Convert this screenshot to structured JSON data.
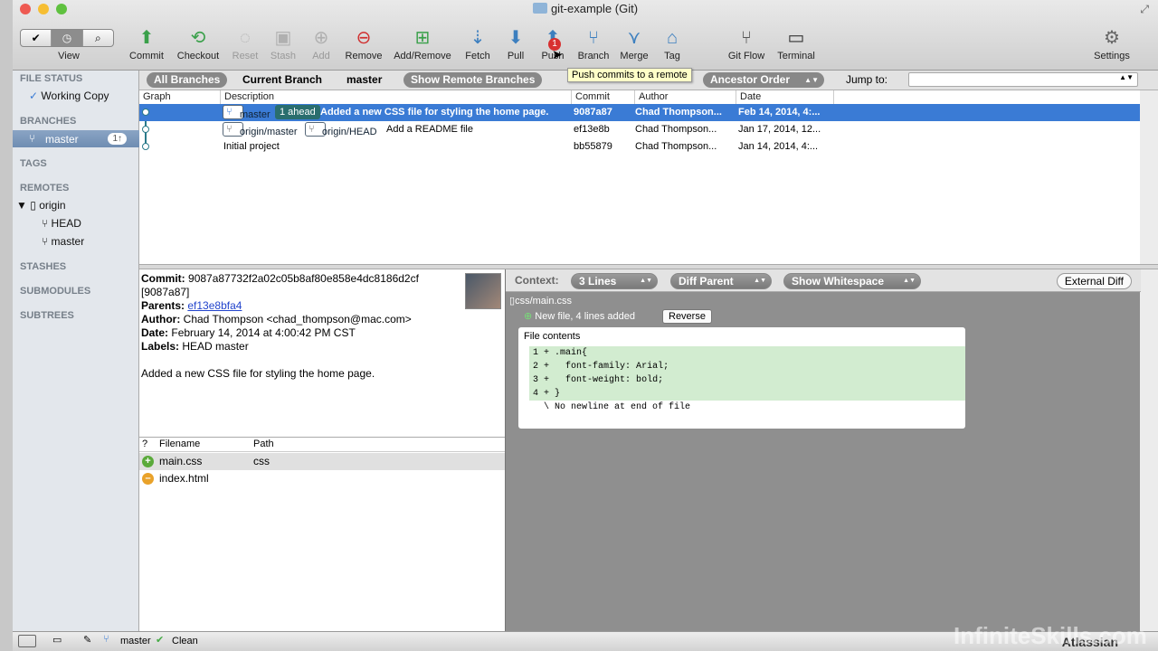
{
  "window": {
    "title": "git-example (Git)"
  },
  "toolbar": {
    "view_label": "View",
    "buttons": [
      {
        "label": "Commit",
        "icon": "commit-icon"
      },
      {
        "label": "Checkout",
        "icon": "checkout-icon"
      },
      {
        "label": "Reset",
        "icon": "reset-icon"
      },
      {
        "label": "Stash",
        "icon": "stash-icon"
      },
      {
        "label": "Add",
        "icon": "add-icon"
      },
      {
        "label": "Remove",
        "icon": "remove-icon"
      },
      {
        "label": "Add/Remove",
        "icon": "add-remove-icon"
      },
      {
        "label": "Fetch",
        "icon": "fetch-icon"
      },
      {
        "label": "Pull",
        "icon": "pull-icon"
      },
      {
        "label": "Push",
        "icon": "push-icon",
        "badge": "1"
      },
      {
        "label": "Branch",
        "icon": "branch-icon"
      },
      {
        "label": "Merge",
        "icon": "merge-icon"
      },
      {
        "label": "Tag",
        "icon": "tag-icon"
      },
      {
        "label": "Git Flow",
        "icon": "git-flow-icon"
      },
      {
        "label": "Terminal",
        "icon": "terminal-icon"
      },
      {
        "label": "Settings",
        "icon": "gear-icon"
      }
    ],
    "tooltip": "Push commits to a remote"
  },
  "sidebar": {
    "file_status": "FILE STATUS",
    "working_copy": "Working Copy",
    "branches": "BRANCHES",
    "branch_master": "master",
    "branch_badge": "1↑",
    "tags": "TAGS",
    "remotes": "REMOTES",
    "remote_origin": "origin",
    "remote_head": "HEAD",
    "remote_master": "master",
    "stashes": "STASHES",
    "submodules": "SUBMODULES",
    "subtrees": "SUBTREES"
  },
  "filterbar": {
    "all_branches": "All Branches",
    "current_branch": "Current Branch",
    "branch": "master",
    "show_remote": "Show Remote Branches",
    "order": "Ancestor Order",
    "jump_to": "Jump to:"
  },
  "commit_table": {
    "headers": [
      "Graph",
      "Description",
      "Commit",
      "Author",
      "Date"
    ],
    "rows": [
      {
        "tags": [
          "master"
        ],
        "ahead": "1 ahead",
        "description": "Added a new CSS file for styling the home page.",
        "commit": "9087a87",
        "author": "Chad Thompson...",
        "date": "Feb 14, 2014, 4:..."
      },
      {
        "tags": [
          "origin/master",
          "origin/HEAD"
        ],
        "description": "Add a README file",
        "commit": "ef13e8b",
        "author": "Chad Thompson...",
        "date": "Jan 17, 2014, 12..."
      },
      {
        "tags": [],
        "description": "Initial project",
        "commit": "bb55879",
        "author": "Chad Thompson...",
        "date": "Jan 14, 2014, 4:..."
      }
    ]
  },
  "details": {
    "commit_label": "Commit:",
    "commit_hash": "9087a87732f2a02c05b8af80e858e4dc8186d2cf",
    "commit_short": "[9087a87]",
    "parents_label": "Parents:",
    "parents": "ef13e8bfa4",
    "author_label": "Author:",
    "author": "Chad Thompson <chad_thompson@mac.com>",
    "date_label": "Date:",
    "date": "February 14, 2014 at 4:00:42 PM CST",
    "labels_label": "Labels:",
    "labels": "HEAD master",
    "message": "Added a new CSS file for styling the home page."
  },
  "files": {
    "headers": [
      "?",
      "Filename",
      "Path"
    ],
    "rows": [
      {
        "status": "added",
        "name": "main.css",
        "path": "css"
      },
      {
        "status": "modified",
        "name": "index.html",
        "path": ""
      }
    ]
  },
  "diff": {
    "context_label": "Context:",
    "context_value": "3 Lines",
    "diff_parent": "Diff Parent",
    "show_whitespace": "Show Whitespace",
    "external_diff": "External Diff",
    "file_path": "css/main.css",
    "file_status": "New file, 4 lines added",
    "reverse": "Reverse",
    "hunk_title": "File contents",
    "lines": [
      {
        "n": "1",
        "sign": "+",
        "text": ".main{"
      },
      {
        "n": "2",
        "sign": "+",
        "text": "  font-family: Arial;"
      },
      {
        "n": "3",
        "sign": "+",
        "text": "  font-weight: bold;"
      },
      {
        "n": "4",
        "sign": "+",
        "text": "}"
      }
    ],
    "no_newline": "No newline at end of file",
    "no_newline_marker": "\\"
  },
  "statusbar": {
    "branch": "master",
    "state": "Clean"
  },
  "watermark": "InfiniteSkills.com",
  "brand": "Atlassian"
}
